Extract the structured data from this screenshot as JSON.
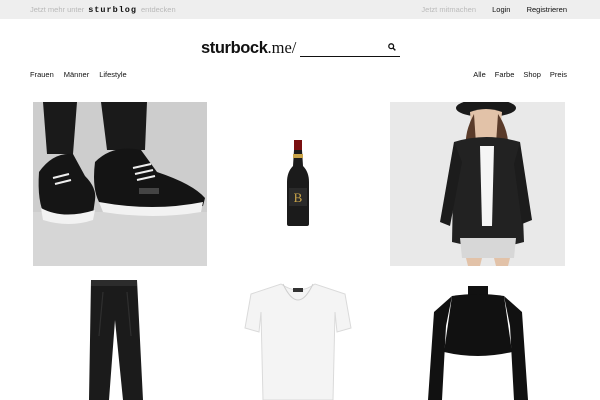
{
  "topbar": {
    "promo_before": "Jetzt mehr unter",
    "promo_brand": "sturblog",
    "promo_after": "entdecken",
    "secondary": "Jetzt mitmachen",
    "login": "Login",
    "register": "Registrieren"
  },
  "header": {
    "logo_bold": "sturbock",
    "logo_rest": ".me/",
    "search_placeholder": "",
    "search_icon": "search-icon"
  },
  "nav_left": [
    "Frauen",
    "Männer",
    "Lifestyle"
  ],
  "nav_right": [
    "Alle",
    "Farbe",
    "Shop",
    "Preis"
  ],
  "products": [
    {
      "name": "sneaker-image"
    },
    {
      "name": "wine-bottle-image"
    },
    {
      "name": "leather-jacket-image"
    },
    {
      "name": "black-pants-image"
    },
    {
      "name": "white-tshirt-image"
    },
    {
      "name": "black-crop-top-image"
    }
  ]
}
